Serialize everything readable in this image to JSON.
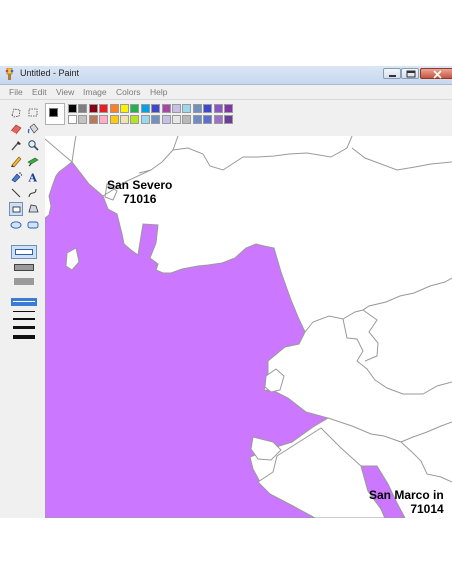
{
  "window": {
    "title": "Untitled - Paint"
  },
  "menu": {
    "items": [
      "File",
      "Edit",
      "View",
      "Image",
      "Colors",
      "Help"
    ]
  },
  "tools": [
    {
      "name": "free-form-select-icon",
      "selected": false
    },
    {
      "name": "select-icon",
      "selected": false
    },
    {
      "name": "eraser-icon",
      "selected": false
    },
    {
      "name": "fill-bucket-icon",
      "selected": false
    },
    {
      "name": "color-picker-icon",
      "selected": false
    },
    {
      "name": "magnifier-icon",
      "selected": false
    },
    {
      "name": "pencil-icon",
      "selected": false
    },
    {
      "name": "brush-icon",
      "selected": false
    },
    {
      "name": "airbrush-icon",
      "selected": false
    },
    {
      "name": "text-icon",
      "selected": false
    },
    {
      "name": "line-icon",
      "selected": false
    },
    {
      "name": "curve-icon",
      "selected": false
    },
    {
      "name": "rectangle-icon",
      "selected": true
    },
    {
      "name": "polygon-icon",
      "selected": false
    },
    {
      "name": "ellipse-icon",
      "selected": false
    },
    {
      "name": "rounded-rectangle-icon",
      "selected": false
    }
  ],
  "palette": {
    "foreground": "#000000",
    "background": "#ffffff",
    "top_row": [
      "#000000",
      "#7f7f7f",
      "#880015",
      "#ed1c24",
      "#ff7f27",
      "#fff200",
      "#22b14c",
      "#00a2e8",
      "#3f48cc",
      "#a349a4",
      "#c8bfe7",
      "#99d9ea",
      "#7092be",
      "#3f48cc",
      "#8b57c0",
      "#8035a8"
    ],
    "bottom_row": [
      "#ffffff",
      "#c3c3c3",
      "#b97a57",
      "#ffaec9",
      "#ffc90e",
      "#efe4b0",
      "#b5e61d",
      "#99d9ea",
      "#7092be",
      "#c8bfe7",
      "#e6e6e6",
      "#b9b9b9",
      "#6e8cc8",
      "#5b6fd1",
      "#a070c8",
      "#6a3d9a"
    ]
  },
  "map": {
    "highlight_color": "#cc77ff",
    "labels": [
      {
        "name": "San Severo",
        "code": "71016"
      },
      {
        "name": "San Marco in",
        "code": "71014"
      }
    ]
  }
}
